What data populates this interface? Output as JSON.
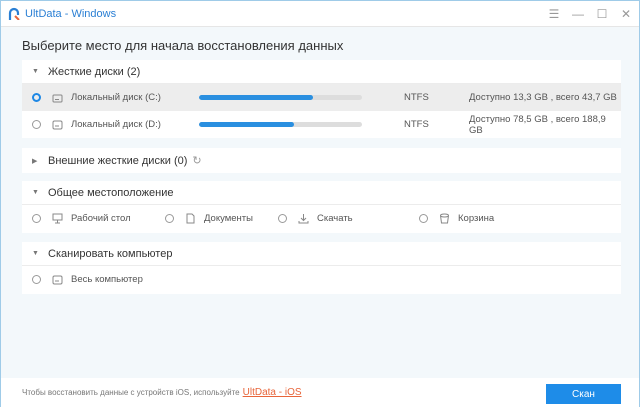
{
  "window": {
    "title": "UltData - Windows",
    "controls": [
      "menu-icon",
      "minimize-icon",
      "maximize-icon",
      "close-icon"
    ]
  },
  "heading": "Выберите место для начала восстановления данных",
  "hard_disks": {
    "label": "Жесткие диски (2)",
    "drives": [
      {
        "name": "Локальный диск (C:)",
        "fs": "NTFS",
        "space": "Доступно 13,3 GB , всего 43,7 GB",
        "used_fraction": 0.7,
        "selected": true
      },
      {
        "name": "Локальный диск (D:)",
        "fs": "NTFS",
        "space": "Доступно 78,5 GB , всего 188,9 GB",
        "used_fraction": 0.58,
        "selected": false
      }
    ]
  },
  "external": {
    "label": "Внешние жесткие диски (0)"
  },
  "common": {
    "label": "Общее местоположение",
    "items": [
      {
        "label": "Рабочий стол",
        "icon": "desktop-icon"
      },
      {
        "label": "Документы",
        "icon": "document-icon"
      },
      {
        "label": "Скачать",
        "icon": "download-icon"
      },
      {
        "label": "Корзина",
        "icon": "trash-icon"
      }
    ]
  },
  "scan_pc": {
    "label": "Сканировать компьютер",
    "item": "Весь компьютер"
  },
  "footer": {
    "text": "Чтобы восстановить данные с устройств iOS, используйте",
    "link": "UltData - iOS",
    "button": "Скан"
  },
  "colors": {
    "accent": "#1e8ce8",
    "link": "#e8653a"
  }
}
